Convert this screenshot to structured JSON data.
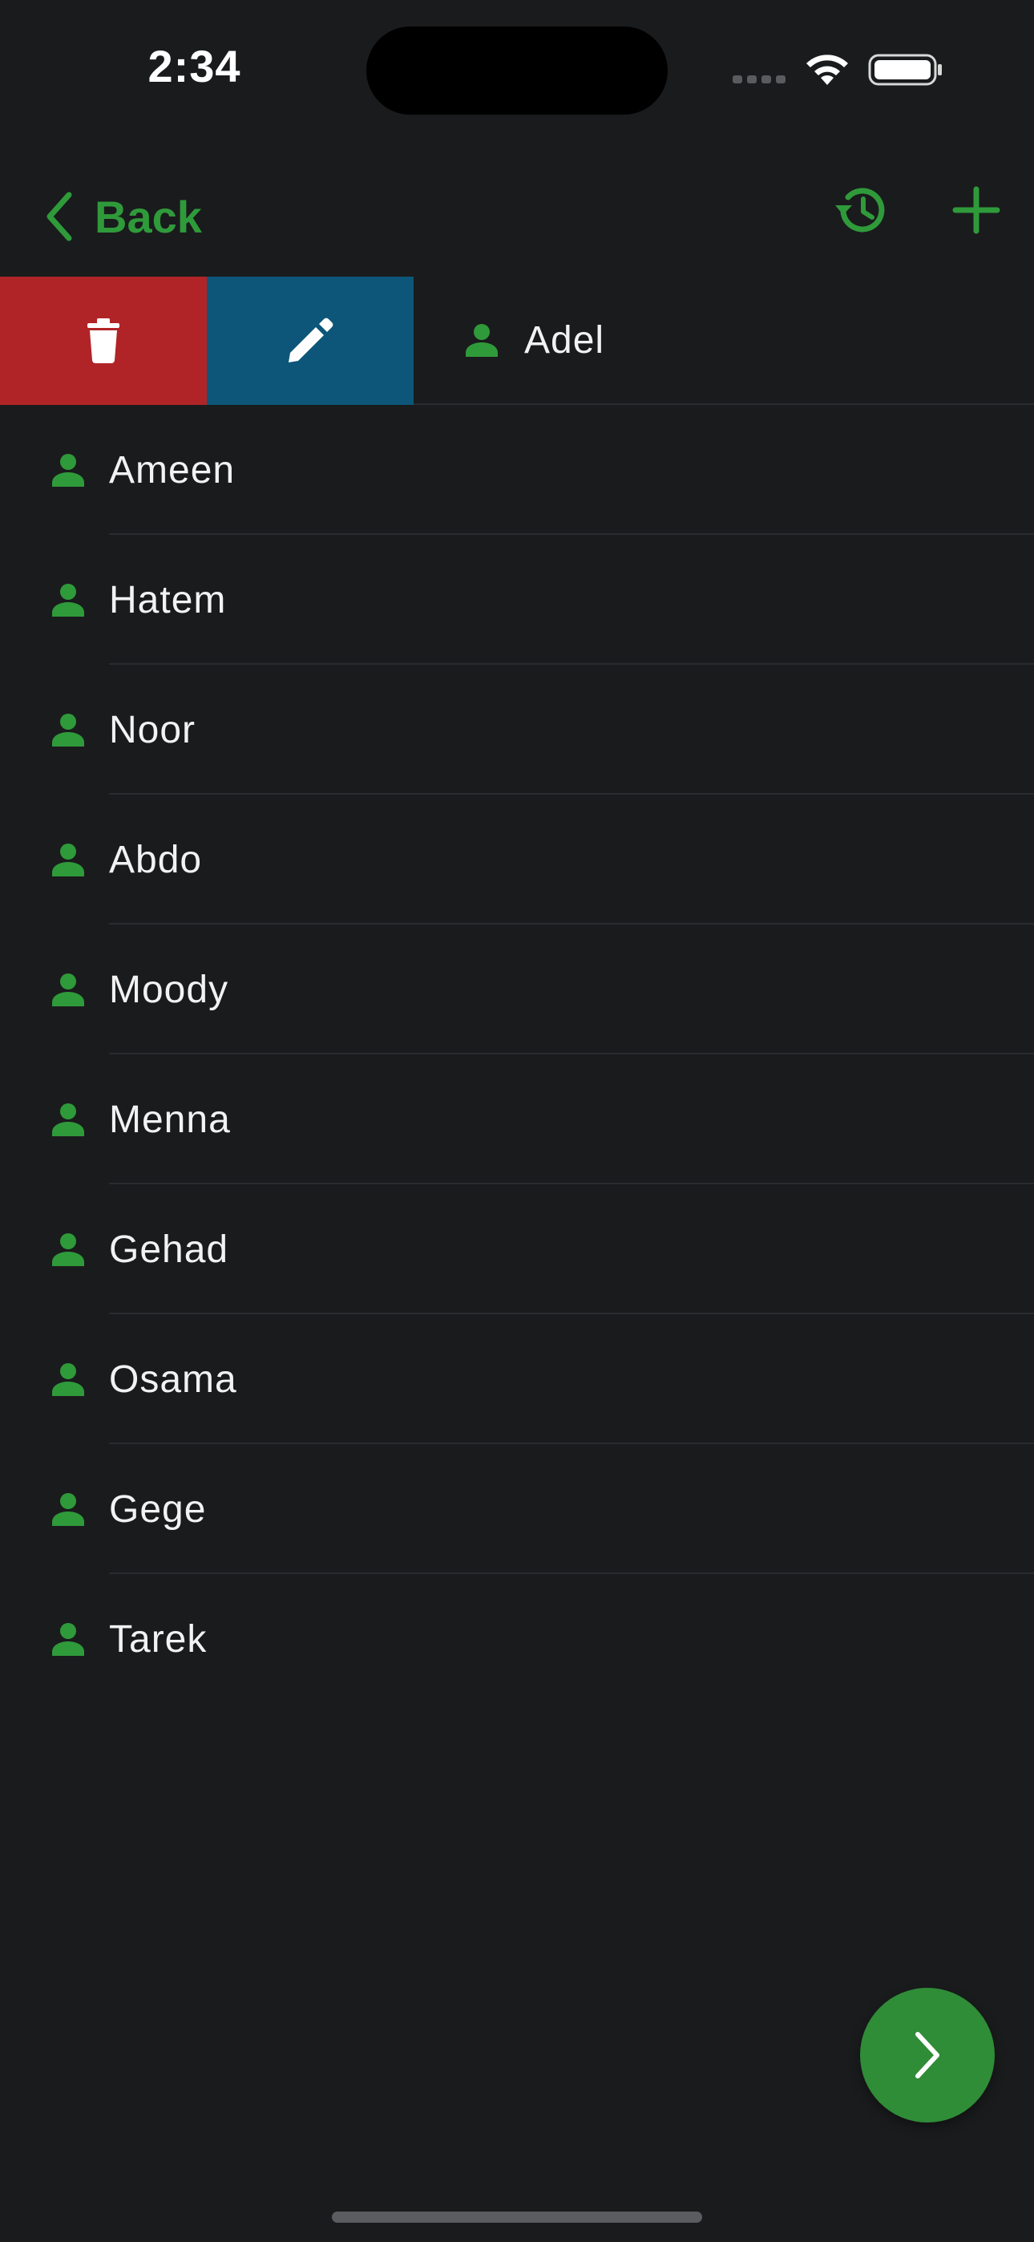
{
  "status_bar": {
    "time": "2:34"
  },
  "nav": {
    "back_label": "Back",
    "history_icon": "history-icon",
    "add_icon": "plus-icon",
    "accent_color": "#2f9a3a"
  },
  "swiped_row": {
    "name": "Adel",
    "delete_icon": "trash-icon",
    "edit_icon": "pencil-icon",
    "delete_color": "#b02427",
    "edit_color": "#0d5679"
  },
  "contacts": [
    {
      "name": "Ameen"
    },
    {
      "name": "Hatem"
    },
    {
      "name": "Noor"
    },
    {
      "name": "Abdo"
    },
    {
      "name": "Moody"
    },
    {
      "name": "Menna"
    },
    {
      "name": "Gehad"
    },
    {
      "name": "Osama"
    },
    {
      "name": "Gege"
    },
    {
      "name": "Tarek"
    }
  ],
  "fab": {
    "icon": "chevron-right-icon",
    "color": "#2f8c37"
  }
}
